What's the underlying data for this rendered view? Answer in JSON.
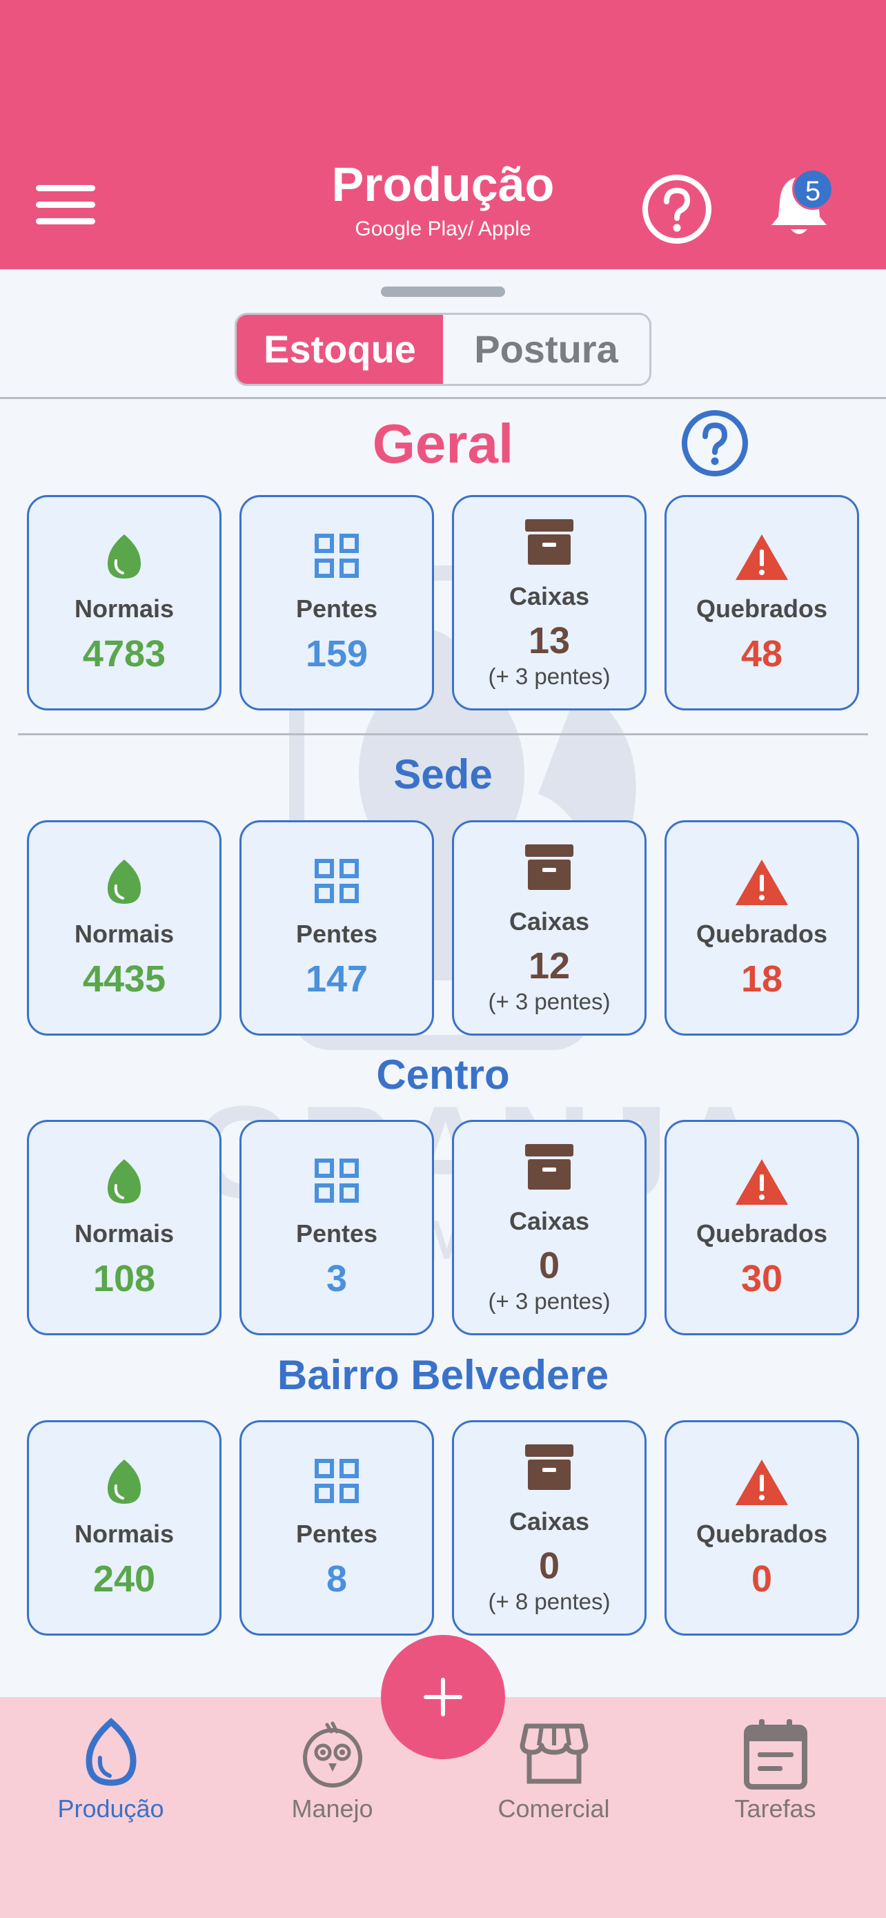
{
  "header": {
    "title": "Produção",
    "subtitle": "Google Play/ Apple",
    "notification_count": "5"
  },
  "tabs": [
    {
      "label": "Estoque",
      "active": true
    },
    {
      "label": "Postura",
      "active": false
    }
  ],
  "watermark": {
    "text": "GRANJA",
    "subtext": "NA MÃO"
  },
  "sections": [
    {
      "title": "Geral",
      "cards": {
        "normais": {
          "label": "Normais",
          "value": "4783"
        },
        "pentes": {
          "label": "Pentes",
          "value": "159"
        },
        "caixas": {
          "label": "Caixas",
          "value": "13",
          "extra": "(+ 3 pentes)"
        },
        "quebrados": {
          "label": "Quebrados",
          "value": "48"
        }
      }
    },
    {
      "title": "Sede",
      "cards": {
        "normais": {
          "label": "Normais",
          "value": "4435"
        },
        "pentes": {
          "label": "Pentes",
          "value": "147"
        },
        "caixas": {
          "label": "Caixas",
          "value": "12",
          "extra": "(+ 3 pentes)"
        },
        "quebrados": {
          "label": "Quebrados",
          "value": "18"
        }
      }
    },
    {
      "title": "Centro",
      "cards": {
        "normais": {
          "label": "Normais",
          "value": "108"
        },
        "pentes": {
          "label": "Pentes",
          "value": "3"
        },
        "caixas": {
          "label": "Caixas",
          "value": "0",
          "extra": "(+ 3 pentes)"
        },
        "quebrados": {
          "label": "Quebrados",
          "value": "30"
        }
      }
    },
    {
      "title": "Bairro Belvedere",
      "cards": {
        "normais": {
          "label": "Normais",
          "value": "240"
        },
        "pentes": {
          "label": "Pentes",
          "value": "8"
        },
        "caixas": {
          "label": "Caixas",
          "value": "0",
          "extra": "(+ 8 pentes)"
        },
        "quebrados": {
          "label": "Quebrados",
          "value": "0"
        }
      }
    }
  ],
  "bottom_nav": [
    {
      "label": "Produção",
      "icon": "egg-icon",
      "active": true
    },
    {
      "label": "Manejo",
      "icon": "chicken-icon",
      "active": false
    },
    {
      "label": "Comercial",
      "icon": "store-icon",
      "active": false
    },
    {
      "label": "Tarefas",
      "icon": "calendar-icon",
      "active": false
    }
  ],
  "colors": {
    "primary": "#ec5480",
    "accent_blue": "#3a72c9",
    "normais": "#5aa64a",
    "pentes": "#4a90dc",
    "caixas": "#6b4a3e",
    "quebrados": "#df4a39",
    "nav_background": "#f8ced7"
  }
}
